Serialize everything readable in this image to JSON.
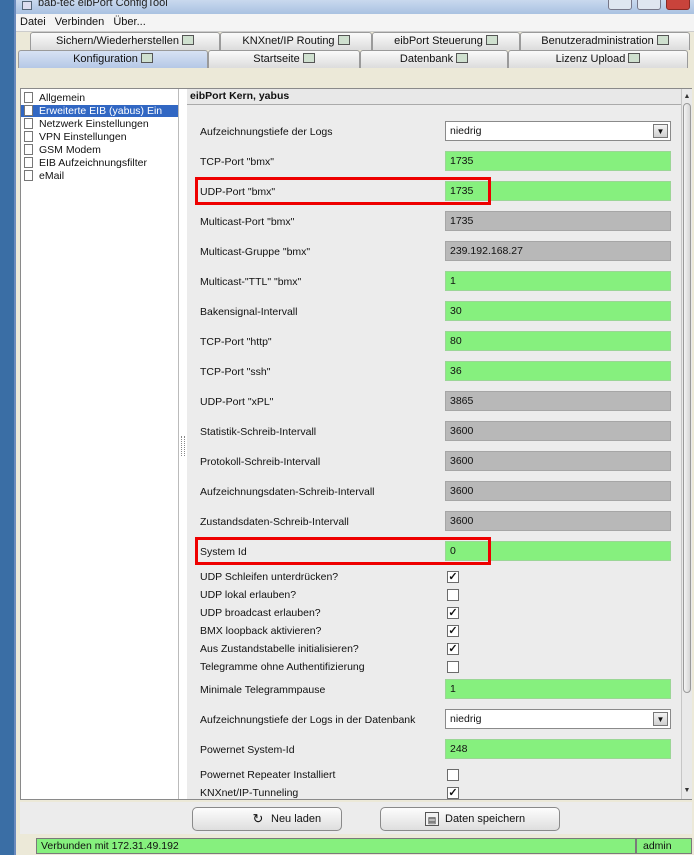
{
  "window": {
    "title": "bab-tec eibPort ConfigTool"
  },
  "menu": [
    "Datei",
    "Verbinden",
    "Über..."
  ],
  "tabs_row1": [
    {
      "label": "Sichern/Wiederherstellen",
      "icon": "backup-icon"
    },
    {
      "label": "KNXnet/IP Routing",
      "icon": "knx-icon"
    },
    {
      "label": "eibPort Steuerung",
      "icon": "monitor-icon"
    },
    {
      "label": "Benutzeradministration",
      "icon": "users-icon"
    }
  ],
  "tabs_row2": [
    {
      "label": "Konfiguration",
      "icon": "config-icon",
      "selected": true
    },
    {
      "label": "Startseite",
      "icon": "home-icon"
    },
    {
      "label": "Datenbank",
      "icon": "database-icon"
    },
    {
      "label": "Lizenz Upload",
      "icon": "key-icon"
    }
  ],
  "sidebar": [
    {
      "label": "Allgemein",
      "selected": false
    },
    {
      "label": "Erweiterte EIB (yabus) Ein",
      "selected": true
    },
    {
      "label": "Netzwerk Einstellungen",
      "selected": false
    },
    {
      "label": "VPN Einstellungen",
      "selected": false
    },
    {
      "label": "GSM Modem",
      "selected": false
    },
    {
      "label": "EIB Aufzeichnungsfilter",
      "selected": false
    },
    {
      "label": "eMail",
      "selected": false
    }
  ],
  "panel": {
    "title": "eibPort Kern, yabus"
  },
  "fields": [
    {
      "label": "Aufzeichnungstiefe der Logs",
      "value": "niedrig",
      "kind": "select"
    },
    {
      "label": "TCP-Port \"bmx\"",
      "value": "1735",
      "kind": "green"
    },
    {
      "label": "UDP-Port \"bmx\"",
      "value": "1735",
      "kind": "green",
      "highlighted": true
    },
    {
      "label": "Multicast-Port \"bmx\"",
      "value": "1735",
      "kind": "gray"
    },
    {
      "label": "Multicast-Gruppe \"bmx\"",
      "value": "239.192.168.27",
      "kind": "gray"
    },
    {
      "label": "Multicast-\"TTL\" \"bmx\"",
      "value": "1",
      "kind": "green"
    },
    {
      "label": "Bakensignal-Intervall",
      "value": "30",
      "kind": "green"
    },
    {
      "label": "TCP-Port \"http\"",
      "value": "80",
      "kind": "green"
    },
    {
      "label": "TCP-Port \"ssh\"",
      "value": "36",
      "kind": "green"
    },
    {
      "label": "UDP-Port \"xPL\"",
      "value": "3865",
      "kind": "gray"
    },
    {
      "label": "Statistik-Schreib-Intervall",
      "value": "3600",
      "kind": "gray"
    },
    {
      "label": "Protokoll-Schreib-Intervall",
      "value": "3600",
      "kind": "gray"
    },
    {
      "label": "Aufzeichnungsdaten-Schreib-Intervall",
      "value": "3600",
      "kind": "gray"
    },
    {
      "label": "Zustandsdaten-Schreib-Intervall",
      "value": "3600",
      "kind": "gray"
    },
    {
      "label": "System Id",
      "value": "0",
      "kind": "green",
      "highlighted": true
    }
  ],
  "checkboxes": [
    {
      "label": "UDP Schleifen unterdrücken?",
      "checked": true
    },
    {
      "label": "UDP lokal erlauben?",
      "checked": false
    },
    {
      "label": "UDP broadcast erlauben?",
      "checked": true
    },
    {
      "label": "BMX loopback aktivieren?",
      "checked": true
    },
    {
      "label": "Aus Zustandstabelle initialisieren?",
      "checked": true
    },
    {
      "label": "Telegramme ohne Authentifizierung",
      "checked": false
    }
  ],
  "fields2": [
    {
      "label": "Minimale Telegrammpause",
      "value": "1",
      "kind": "green"
    },
    {
      "label": "Aufzeichnungstiefe der Logs in der Datenbank",
      "value": "niedrig",
      "kind": "select"
    },
    {
      "label": "Powernet System-Id",
      "value": "248",
      "kind": "green"
    }
  ],
  "checkboxes2": [
    {
      "label": "Powernet Repeater Installiert",
      "checked": false
    },
    {
      "label": "KNXnet/IP-Tunneling",
      "checked": true
    }
  ],
  "buttons": {
    "reload": "Neu laden",
    "save": "Daten speichern"
  },
  "status": {
    "message": "Verbunden mit 172.31.49.192",
    "user": "admin"
  },
  "colors": {
    "valid_field": "#86f07e",
    "readonly_field": "#b8b8b8",
    "highlight": "#e00000",
    "selection": "#3167c3"
  }
}
